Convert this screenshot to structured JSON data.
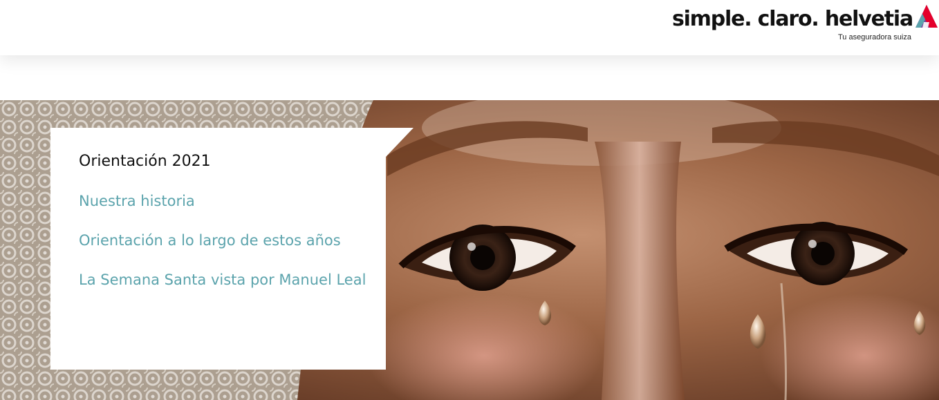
{
  "brand": {
    "wordmark": "simple. claro. helvetia",
    "tagline": "Tu aseguradora suiza",
    "logo_colors": [
      "#e4002b",
      "#7a3f98",
      "#5ba3ac"
    ]
  },
  "nav_card": {
    "title": "Orientación 2021",
    "links": [
      {
        "label": "Nuestra historia"
      },
      {
        "label": "Orientación a lo largo de estos años"
      },
      {
        "label": "La Semana Santa vista por Manuel Leal"
      }
    ],
    "link_color": "#5ba3ac"
  },
  "hero": {
    "image": "close-up of a carved statue's face with tears"
  }
}
